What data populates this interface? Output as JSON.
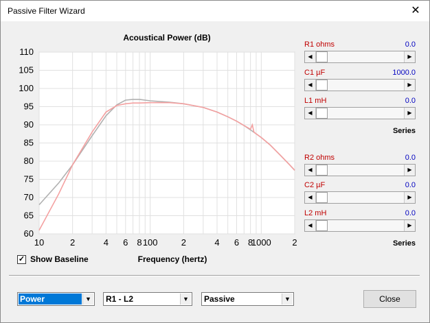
{
  "window": {
    "title": "Passive Filter Wizard",
    "close_glyph": "✕"
  },
  "chart_data": {
    "type": "line",
    "title": "Acoustical Power (dB)",
    "xlabel": "Frequency (hertz)",
    "ylabel": "",
    "x_scale": "log",
    "xlim": [
      10,
      2000
    ],
    "ylim": [
      60,
      110
    ],
    "y_ticks": [
      60,
      65,
      70,
      75,
      80,
      85,
      90,
      95,
      100,
      105,
      110
    ],
    "x_tick_labels": [
      {
        "value": 10,
        "label": "10"
      },
      {
        "value": 20,
        "label": "2"
      },
      {
        "value": 40,
        "label": "4"
      },
      {
        "value": 60,
        "label": "6"
      },
      {
        "value": 80,
        "label": "8"
      },
      {
        "value": 100,
        "label": "100"
      },
      {
        "value": 200,
        "label": "2"
      },
      {
        "value": 400,
        "label": "4"
      },
      {
        "value": 600,
        "label": "6"
      },
      {
        "value": 800,
        "label": "8"
      },
      {
        "value": 1000,
        "label": "1000"
      },
      {
        "value": 2000,
        "label": "2"
      }
    ],
    "grid": true,
    "series": [
      {
        "color": "#b0b0b0",
        "points": [
          [
            10,
            68
          ],
          [
            15,
            74
          ],
          [
            20,
            79
          ],
          [
            30,
            87
          ],
          [
            40,
            92.5
          ],
          [
            50,
            95.5
          ],
          [
            60,
            96.8
          ],
          [
            70,
            97
          ],
          [
            80,
            97
          ],
          [
            100,
            96.6
          ],
          [
            150,
            96.2
          ],
          [
            200,
            95.8
          ],
          [
            300,
            94.8
          ],
          [
            400,
            93.5
          ],
          [
            500,
            92.2
          ],
          [
            600,
            91
          ],
          [
            700,
            89.8
          ],
          [
            800,
            88.6
          ],
          [
            1000,
            86.5
          ],
          [
            1200,
            84.5
          ],
          [
            1500,
            81.5
          ],
          [
            1800,
            79
          ],
          [
            2000,
            77.5
          ]
        ]
      },
      {
        "color": "#f4a0a0",
        "points": [
          [
            10,
            61
          ],
          [
            15,
            71
          ],
          [
            20,
            79
          ],
          [
            30,
            88
          ],
          [
            40,
            93.5
          ],
          [
            50,
            95.3
          ],
          [
            60,
            95.8
          ],
          [
            70,
            96
          ],
          [
            80,
            96
          ],
          [
            100,
            96.1
          ],
          [
            150,
            96.1
          ],
          [
            200,
            95.8
          ],
          [
            300,
            94.8
          ],
          [
            400,
            93.5
          ],
          [
            500,
            92.2
          ],
          [
            600,
            91
          ],
          [
            700,
            89.8
          ],
          [
            800,
            88.8
          ],
          [
            830,
            90
          ],
          [
            860,
            88
          ],
          [
            1000,
            86.5
          ],
          [
            1200,
            84.5
          ],
          [
            1500,
            81.5
          ],
          [
            1800,
            79
          ],
          [
            2000,
            77.5
          ]
        ]
      }
    ]
  },
  "baseline": {
    "label": "Show Baseline",
    "checked": true,
    "check_glyph": "✓"
  },
  "controls": {
    "group1": [
      {
        "name": "R1  ohms",
        "value": "0.0",
        "thumb": 0
      },
      {
        "name": "C1  µF",
        "value": "1000.0",
        "thumb": 0
      },
      {
        "name": "L1  mH",
        "value": "0.0",
        "thumb": 0
      }
    ],
    "group1_mode": "Series",
    "group2": [
      {
        "name": "R2  ohms",
        "value": "0.0",
        "thumb": 0
      },
      {
        "name": "C2  µF",
        "value": "0.0",
        "thumb": 0
      },
      {
        "name": "L2  mH",
        "value": "0.0",
        "thumb": 0
      }
    ],
    "group2_mode": "Series"
  },
  "footer": {
    "combo1": "Power",
    "combo2": "R1 - L2",
    "combo3": "Passive",
    "close_label": "Close"
  },
  "glyphs": {
    "left": "◀",
    "right": "▶",
    "down": "▼"
  }
}
